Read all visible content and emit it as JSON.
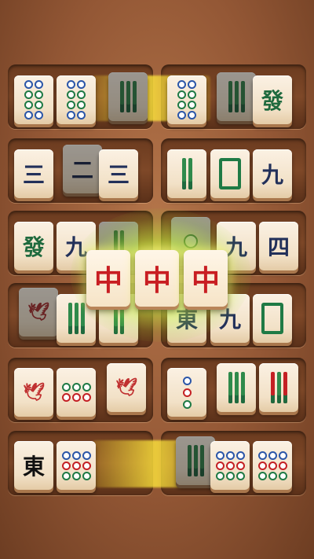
{
  "tiles": {
    "char_three": "三",
    "char_two": "二",
    "char_nine": "九",
    "char_four": "四",
    "green_dragon": "發",
    "red_dragon": "中",
    "east_wind": "東",
    "bird_symbol": "🕊"
  },
  "colors": {
    "dot_blue": "#2b56a8",
    "dot_green": "#1f7a45",
    "dot_red": "#c42024",
    "glow": "#ffe03c"
  }
}
